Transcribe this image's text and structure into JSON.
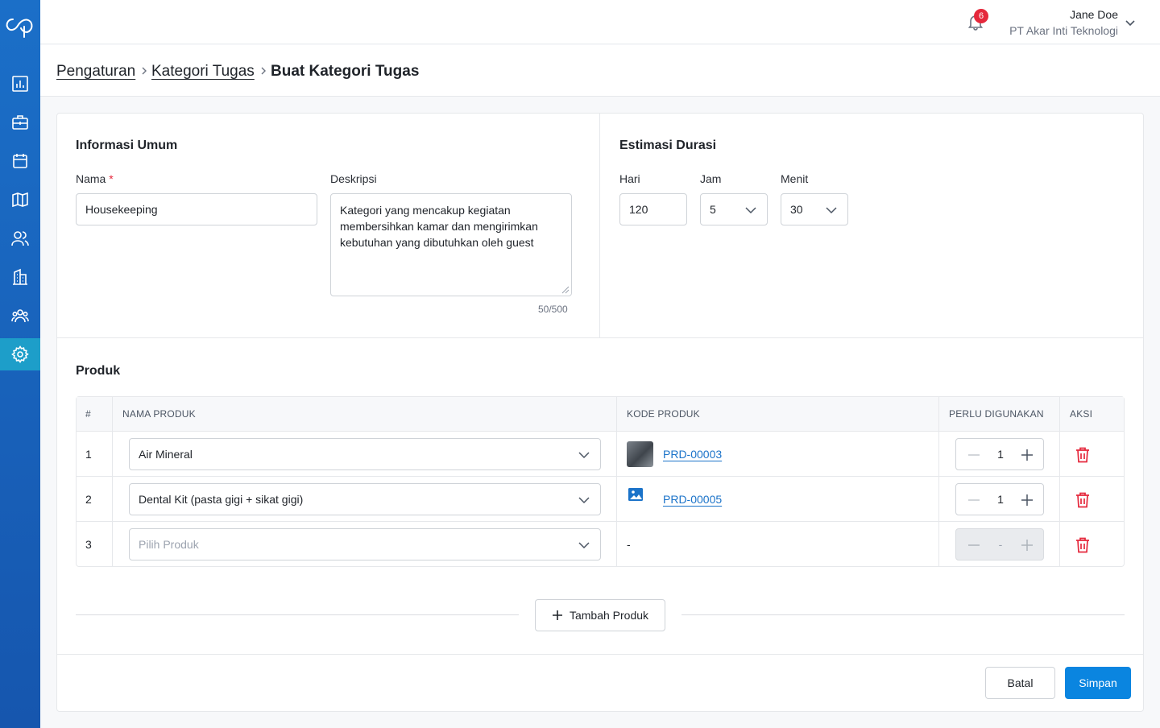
{
  "topbar": {
    "notification_count": "6",
    "user_name": "Jane Doe",
    "company": "PT Akar Inti Teknologi"
  },
  "breadcrumb": {
    "items": [
      "Pengaturan",
      "Kategori Tugas"
    ],
    "current": "Buat Kategori Tugas"
  },
  "general": {
    "title": "Informasi Umum",
    "name_label": "Nama",
    "required_mark": "*",
    "name_value": "Housekeeping",
    "description_label": "Deskripsi",
    "description_value": "Kategori yang mencakup kegiatan membersihkan kamar dan mengirimkan kebutuhan yang dibutuhkan oleh guest",
    "counter": "50/500"
  },
  "duration": {
    "title": "Estimasi Durasi",
    "day_label": "Hari",
    "day_value": "120",
    "hour_label": "Jam",
    "hour_value": "5",
    "minute_label": "Menit",
    "minute_value": "30"
  },
  "products": {
    "title": "Produk",
    "columns": [
      "#",
      "NAMA PRODUK",
      "KODE PRODUK",
      "PERLU DIGUNAKAN",
      "AKSI"
    ],
    "rows": [
      {
        "num": "1",
        "name": "Air Mineral",
        "code": "PRD-00003",
        "qty": "1"
      },
      {
        "num": "2",
        "name": "Dental Kit (pasta gigi + sikat gigi)",
        "code": "PRD-00005",
        "qty": "1"
      },
      {
        "num": "3",
        "placeholder": "Pilih Produk",
        "code": "-",
        "qty": "-"
      }
    ],
    "add_label": "Tambah Produk"
  },
  "footer": {
    "cancel_label": "Batal",
    "save_label": "Simpan"
  },
  "colors": {
    "sidebar": "#1656ae",
    "sidebar_active": "#1d9ec9",
    "primary": "#0a85e0",
    "danger": "#e5283c",
    "link": "#1b73c9"
  },
  "icons": {
    "sidebar": [
      "dashboard-icon",
      "briefcase-icon",
      "calendar-icon",
      "map-icon",
      "users-icon",
      "building-icon",
      "team-icon",
      "settings-icon"
    ]
  }
}
